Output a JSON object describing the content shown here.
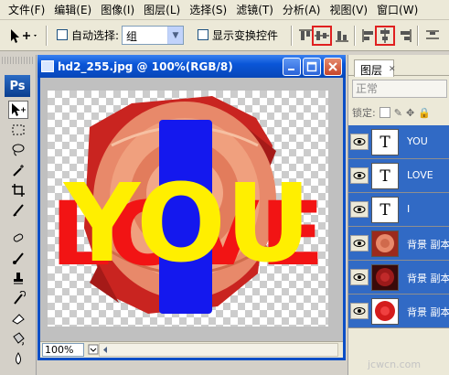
{
  "menu": [
    "文件(F)",
    "编辑(E)",
    "图像(I)",
    "图层(L)",
    "选择(S)",
    "滤镜(T)",
    "分析(A)",
    "视图(V)",
    "窗口(W)"
  ],
  "options": {
    "auto_select_label": "自动选择:",
    "auto_select_value": "组",
    "show_transform_label": "显示变换控件"
  },
  "document": {
    "title": "hd2_255.jpg @ 100%(RGB/8)",
    "zoom": "100%"
  },
  "artwork": {
    "back_text": "LOVE",
    "back_text_color": "#f21414",
    "front_text": "YOU",
    "front_text_color": "#ffef00",
    "i_color": "#1418ee",
    "rose_color": "#e8896a"
  },
  "layers_panel": {
    "tab_label": "图层",
    "blend_mode": "正常",
    "lock_label": "锁定:",
    "layers": [
      {
        "name": "YOU",
        "thumb": "T"
      },
      {
        "name": "LOVE",
        "thumb": "T"
      },
      {
        "name": "I",
        "thumb": "T"
      },
      {
        "name": "背景 副本",
        "thumb": "rose"
      },
      {
        "name": "背景 副本",
        "thumb": "rose-dark"
      },
      {
        "name": "背景 副本",
        "thumb": "rose-red"
      }
    ]
  },
  "watermark": "jcwcn.com"
}
